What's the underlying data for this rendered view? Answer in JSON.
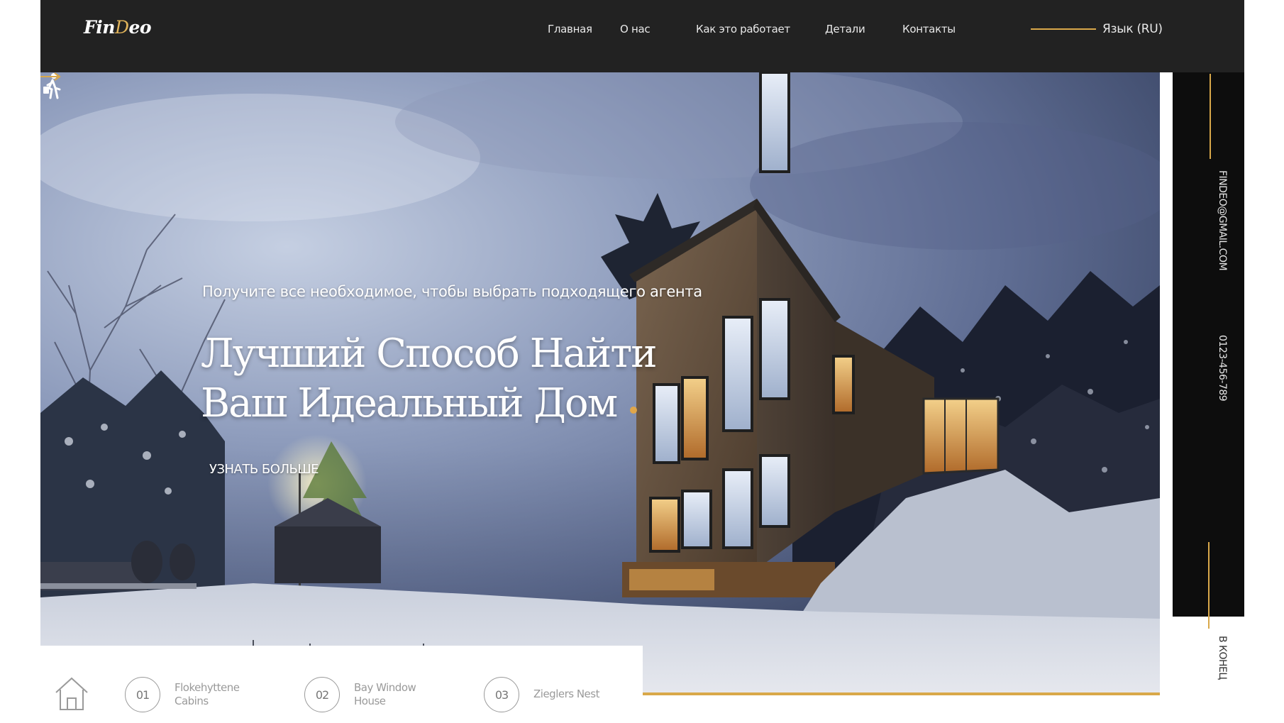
{
  "header": {
    "logo": {
      "part1": "Fin",
      "part2": "D",
      "part3": "eo"
    },
    "nav": [
      {
        "label": "Главная"
      },
      {
        "label": "О нас"
      },
      {
        "label": "Как это работает"
      },
      {
        "label": "Детали"
      },
      {
        "label": "Контакты"
      }
    ],
    "language": "Язык (RU)"
  },
  "sidebar": {
    "email": "FINDEO@GMAIL.COM",
    "phone": "0123-456-789",
    "scroll_end": "В КОНЕЦ"
  },
  "hero": {
    "tagline": "Получите все необходимое, чтобы выбрать подходящего агента",
    "headline_line1": "Лучший Способ Найти",
    "headline_line2": "Ваш Идеальный Дом",
    "cta": "УЗНАТЬ БОЛЬШЕ",
    "icons": {
      "tagline": "person-walking-icon",
      "cta": "arrow-right-icon"
    }
  },
  "properties": {
    "home_icon": "house-icon",
    "items": [
      {
        "number": "01",
        "name_line1": "Flokehyttene",
        "name_line2": "Cabins"
      },
      {
        "number": "02",
        "name_line1": "Bay Window",
        "name_line2": "House"
      },
      {
        "number": "03",
        "name_line1": "Zieglers Nest",
        "name_line2": ""
      }
    ]
  },
  "colors": {
    "accent": "#d9a84a",
    "header_bg": "#222222",
    "sidebar_bg": "#0d0d0d"
  }
}
